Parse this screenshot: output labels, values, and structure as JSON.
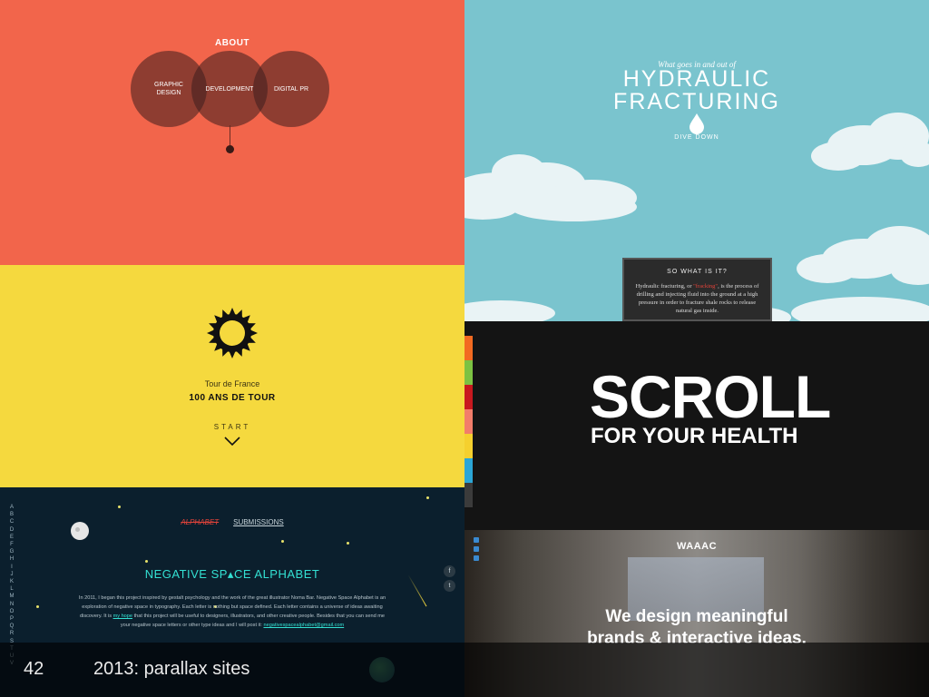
{
  "about": {
    "title": "ABOUT",
    "circles": [
      "GRAPHIC\nDESIGN",
      "DEVELOPMENT",
      "DIGITAL PR"
    ]
  },
  "fracking": {
    "kicker": "What goes in and out of",
    "title_line1": "HYDRAULIC",
    "title_line2": "FRACTURING",
    "dive_label": "DIVE DOWN",
    "box_heading": "SO WHAT IS IT?",
    "box_text_before": "Hydraulic fracturing, or ",
    "box_text_highlight": "\"fracking\"",
    "box_text_after": ", is the process of drilling and injecting fluid into the ground at a high pressure in order to fracture shale rocks to release natural gas inside.",
    "sky_color": "#7ac4ce",
    "highlight_color": "#e2433a"
  },
  "tour": {
    "subtitle": "Tour de France",
    "title": "100 ANS DE TOUR",
    "start_label": "START",
    "background_color": "#f5d93e"
  },
  "scroll": {
    "headline": "SCROLL",
    "subheadline": "FOR YOUR HEALTH",
    "side_colors": [
      "#f26a21",
      "#7cc242",
      "#c8191f",
      "#f27d6a",
      "#f5d02e",
      "#2ba6d6",
      "#3b3b3b"
    ]
  },
  "alphabet": {
    "letters": [
      "A",
      "B",
      "C",
      "D",
      "E",
      "F",
      "G",
      "H",
      "I",
      "J",
      "K",
      "L",
      "M",
      "N",
      "O",
      "P",
      "Q",
      "R",
      "S",
      "T",
      "U",
      "V"
    ],
    "nav_alphabet": "ALPHABET",
    "nav_submissions": "SUBMISSIONS",
    "title": "NEGATIVE SP▴CE ALPHABET",
    "body_before": "In 2011, I began this project inspired by gestalt psychology and the work of the great illustrator Noma Bar. Negative Space Alphabet is an exploration of negative space in typography. Each letter is nothing but space defined. Each letter contains a universe of ideas awaiting discovery. It is ",
    "body_link": "my hope",
    "body_middle": " that this project will be useful to designers, illustrators, and other creative people. Besides that you can send me your negative space letters or other type ideas and I will post it: ",
    "body_email": "negativespacealphabet@gmail.com",
    "social_icons": [
      "facebook-icon",
      "twitter-icon"
    ],
    "social_glyphs": [
      "f",
      "t"
    ],
    "accent_color": "#33e0d2"
  },
  "waaac": {
    "logo": "WAAAC",
    "tagline_line1": "We design meaningful",
    "tagline_line2": "brands & interactive ideas."
  },
  "slide": {
    "number": "42",
    "caption": "2013: parallax sites"
  }
}
